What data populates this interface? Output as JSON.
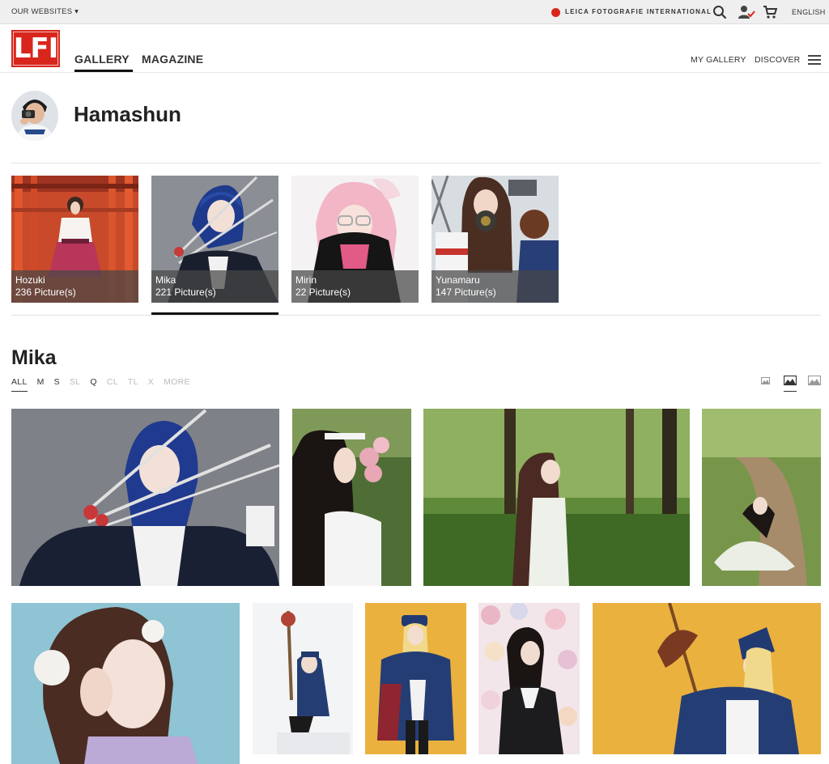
{
  "topbar": {
    "our_websites": "OUR WEBSITES ▾",
    "leica_link": "LEICA FOTOGRAFIE INTERNATIONAL",
    "language": "ENGLISH",
    "icons": [
      "search-icon",
      "user-check-icon",
      "cart-icon"
    ]
  },
  "header": {
    "logo": "LFI",
    "nav": {
      "gallery": "GALLERY",
      "magazine": "MAGAZINE"
    },
    "right": {
      "my_gallery": "MY GALLERY",
      "discover": "DISCOVER"
    }
  },
  "profile": {
    "name": "Hamashun"
  },
  "albums": [
    {
      "title": "Hozuki",
      "count": "236 Picture(s)"
    },
    {
      "title": "Mika",
      "count": "221 Picture(s)"
    },
    {
      "title": "Mirin",
      "count": "22 Picture(s)"
    },
    {
      "title": "Yunamaru",
      "count": "147 Picture(s)"
    }
  ],
  "section": {
    "title": "Mika",
    "filters": [
      "ALL",
      "M",
      "S",
      "SL",
      "Q",
      "CL",
      "TL",
      "X",
      "MORE"
    ],
    "active_filter": "ALL"
  },
  "colors": {
    "brand_red": "#d9261c",
    "caption_bg": "#464646"
  }
}
